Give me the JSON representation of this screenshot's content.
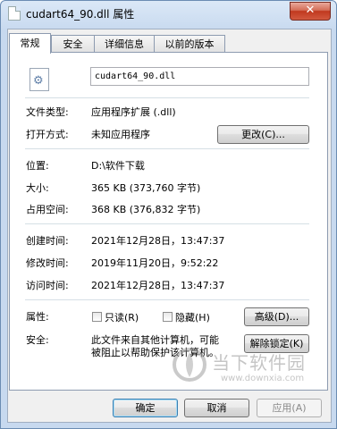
{
  "window": {
    "title": "cudart64_90.dll 属性",
    "close_glyph": "✕"
  },
  "tabs": [
    {
      "label": "常规",
      "active": true
    },
    {
      "label": "安全",
      "active": false
    },
    {
      "label": "详细信息",
      "active": false
    },
    {
      "label": "以前的版本",
      "active": false
    }
  ],
  "file": {
    "name": "cudart64_90.dll",
    "icon": "dll-gear-icon"
  },
  "properties": {
    "file_type_label": "文件类型:",
    "file_type_value": "应用程序扩展 (.dll)",
    "open_with_label": "打开方式:",
    "open_with_value": "未知应用程序",
    "change_button": "更改(C)...",
    "location_label": "位置:",
    "location_value": "D:\\软件下载",
    "size_label": "大小:",
    "size_value": "365 KB (373,760 字节)",
    "size_on_disk_label": "占用空间:",
    "size_on_disk_value": "368 KB (376,832 字节)",
    "created_label": "创建时间:",
    "created_value": "2021年12月28日，13:47:37",
    "modified_label": "修改时间:",
    "modified_value": "2019年11月20日，9:52:22",
    "accessed_label": "访问时间:",
    "accessed_value": "2021年12月28日，13:47:37",
    "attributes_label": "属性:",
    "readonly_label": "只读(R)",
    "readonly_checked": false,
    "hidden_label": "隐藏(H)",
    "hidden_checked": false,
    "advanced_button": "高级(D)...",
    "security_label": "安全:",
    "security_text_line1": "此文件来自其他计算机，可能",
    "security_text_line2": "被阻止以帮助保护该计算机。",
    "unblock_button": "解除锁定(K)"
  },
  "footer": {
    "ok": "确定",
    "cancel": "取消",
    "apply": "应用(A)"
  },
  "watermark": {
    "text": "当下软件园",
    "url": "www.downxia.com"
  }
}
